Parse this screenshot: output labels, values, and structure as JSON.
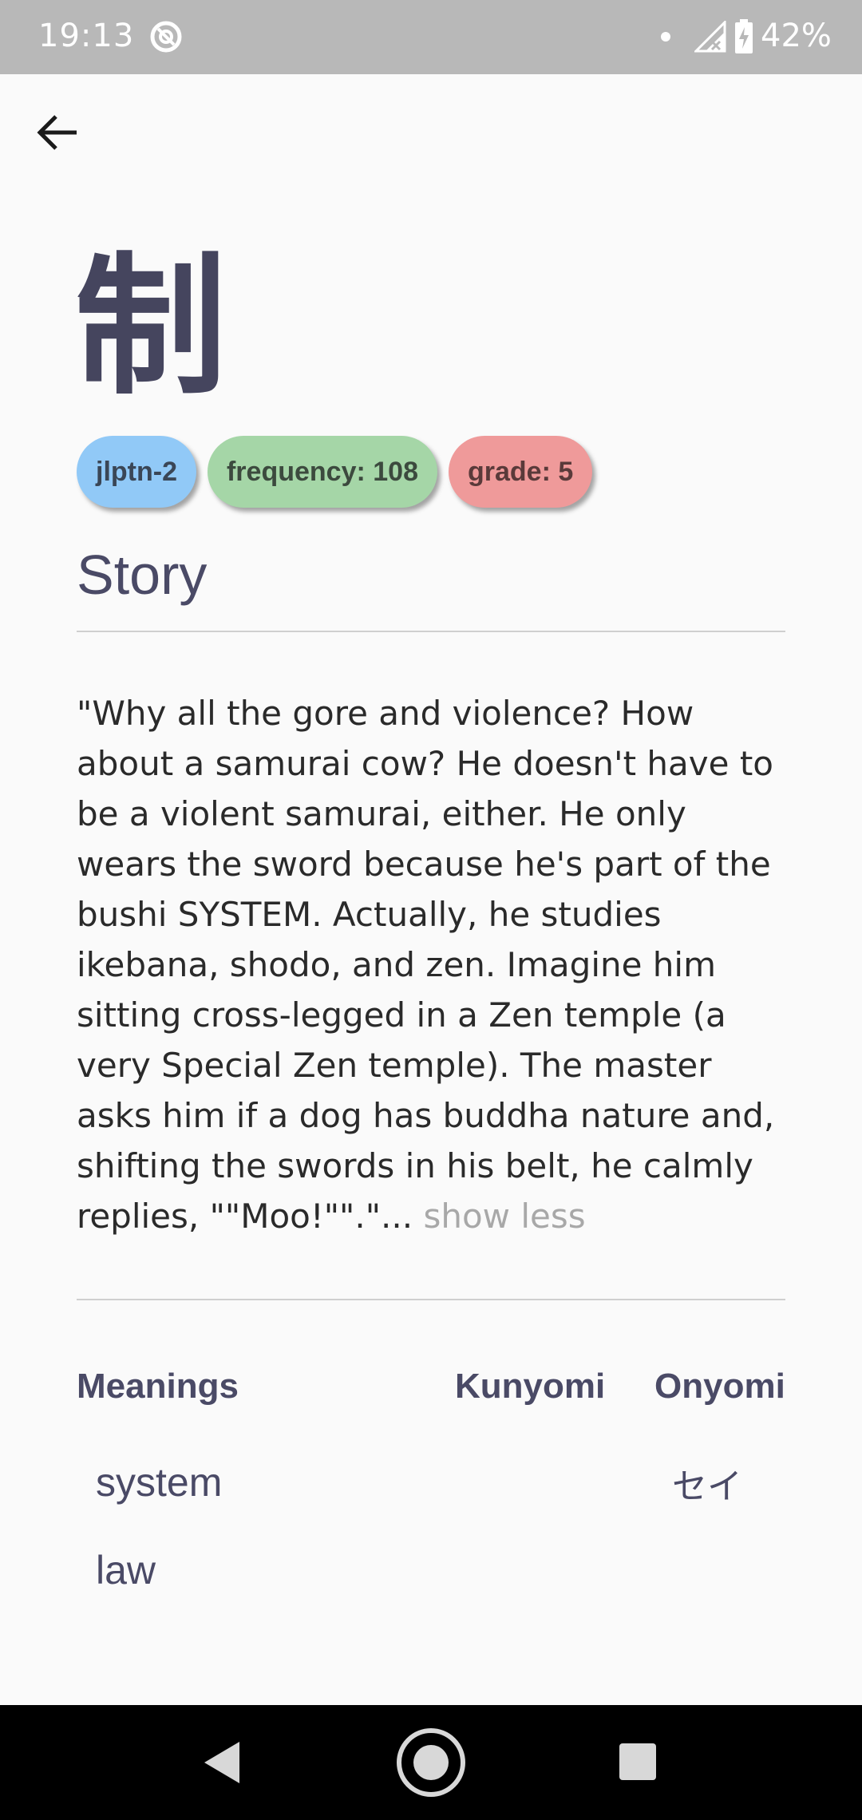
{
  "status_bar": {
    "time": "19:13",
    "battery_percent": "42%",
    "app_icon": "assistant-icon",
    "signal_icon": "signal-no-service-icon",
    "battery_icon": "battery-charging-icon"
  },
  "toolbar": {
    "back_icon": "arrow-left-icon"
  },
  "kanji": {
    "character": "制",
    "color": "#45455e"
  },
  "chips": [
    {
      "label": "jlptn-2",
      "color": "#91c9f7"
    },
    {
      "label": "frequency: 108",
      "color": "#a5d6a7"
    },
    {
      "label": "grade: 5",
      "color": "#ef9a9a"
    }
  ],
  "story": {
    "heading": "Story",
    "text": "\"Why all the gore and violence? How about a samurai cow? He doesn't have to be a violent samurai, either. He only wears the sword because he's part of the bushi SYSTEM. Actually, he studies ikebana, shodo, and zen. Imagine him sitting cross-legged in a Zen temple (a very Special Zen temple). The master asks him if a dog has buddha nature and, shifting the swords in his belt, he calmly replies, \"\"Moo!\"\".\"...",
    "toggle_label": "show less"
  },
  "table": {
    "headers": {
      "meanings": "Meanings",
      "kunyomi": "Kunyomi",
      "onyomi": "Onyomi"
    },
    "meanings": [
      "system",
      "law"
    ],
    "kunyomi": [],
    "onyomi": [
      "セイ"
    ]
  },
  "nav_bar": {
    "back_icon": "nav-back-triangle-icon",
    "home_icon": "nav-home-circle-icon",
    "recents_icon": "nav-recents-square-icon"
  }
}
